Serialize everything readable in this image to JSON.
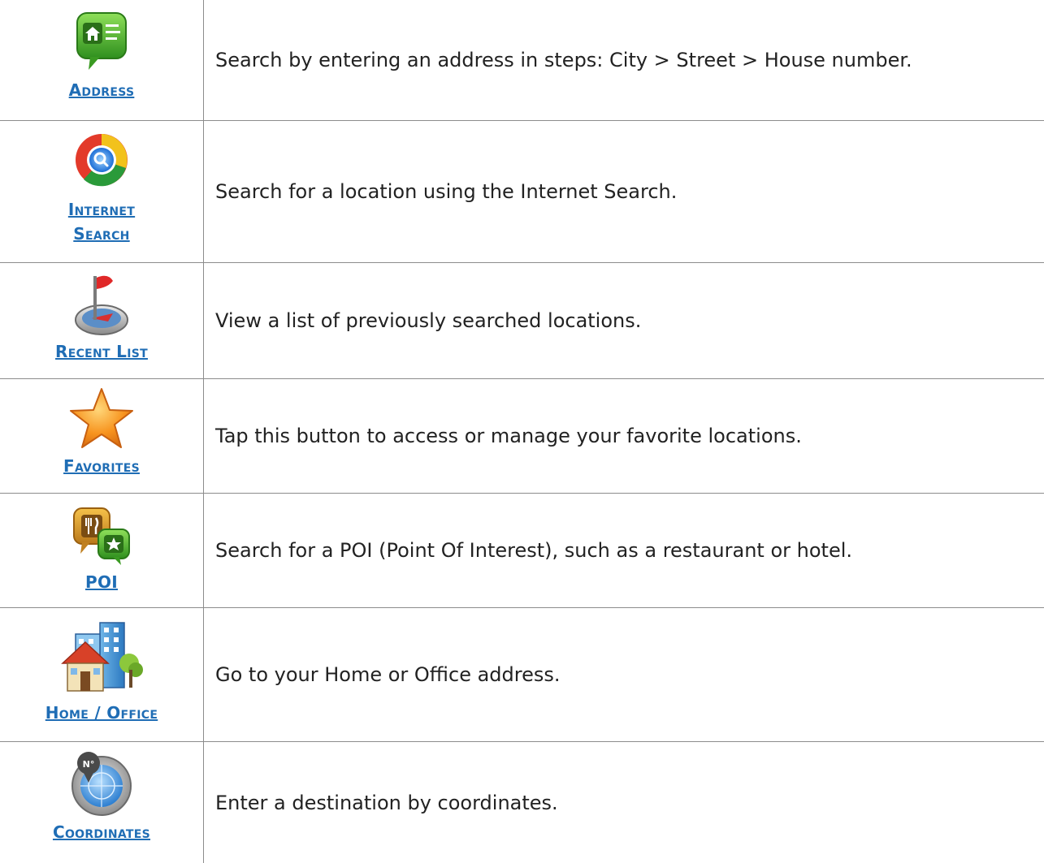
{
  "rows": [
    {
      "icon": "address-book-icon",
      "label": "Address",
      "description": "Search by entering an address in steps: City > Street > House number."
    },
    {
      "icon": "internet-search-icon",
      "label": "Internet Search",
      "label_lines": [
        "Internet",
        "Search"
      ],
      "description": "Search for a location using the Internet Search."
    },
    {
      "icon": "recent-flag-compass-icon",
      "label": "Recent List",
      "description": "View a list of previously searched locations."
    },
    {
      "icon": "star-icon",
      "label": "Favorites",
      "description": "Tap this button to access or manage your favorite locations."
    },
    {
      "icon": "poi-icon",
      "label": "POI",
      "description": "Search for a POI (Point Of Interest), such as a restaurant or hotel."
    },
    {
      "icon": "home-office-buildings-icon",
      "label": "Home / Office",
      "description": "Go to your Home or Office address."
    },
    {
      "icon": "coordinates-radar-icon",
      "label": "Coordinates",
      "description": "Enter a destination by coordinates."
    }
  ],
  "colors": {
    "link": "#1f6db5",
    "text": "#222222",
    "border": "#8c8c8c"
  }
}
